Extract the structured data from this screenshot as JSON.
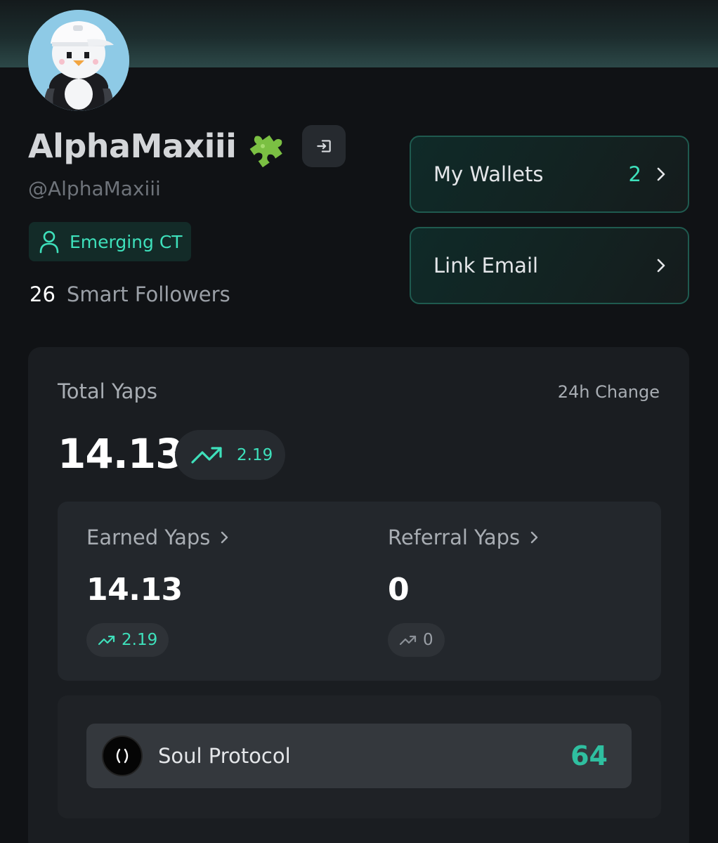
{
  "profile": {
    "display_name": "AlphaMaxiii",
    "handle": "@AlphaMaxiii",
    "name_emoji": "puzzle-piece",
    "tier_badge": "Emerging CT",
    "smart_followers_count": "26",
    "smart_followers_label": "Smart Followers"
  },
  "actions": {
    "wallets_label": "My Wallets",
    "wallets_count": "2",
    "email_label": "Link Email"
  },
  "yaps": {
    "total_label": "Total Yaps",
    "change_label": "24h Change",
    "total_value": "14.13",
    "total_change": "2.19",
    "earned_label": "Earned Yaps",
    "earned_value": "14.13",
    "earned_change": "2.19",
    "referral_label": "Referral Yaps",
    "referral_value": "0",
    "referral_change": "0"
  },
  "protocol": {
    "name": "Soul Protocol",
    "score": "64"
  },
  "colors": {
    "accent": "#3ee0bb",
    "background": "#101215",
    "card": "#1a1d21",
    "muted_text": "#a8adb3"
  }
}
